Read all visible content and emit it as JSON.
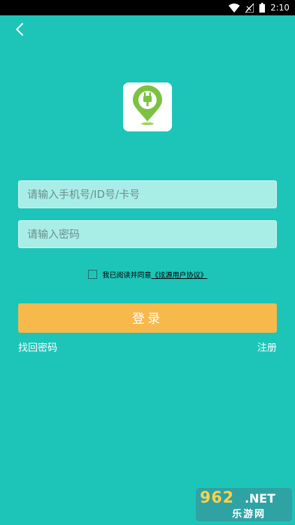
{
  "status_bar": {
    "time": "2:10",
    "icons": [
      "wifi-icon",
      "no-signal-icon",
      "battery-icon"
    ]
  },
  "header": {
    "back_icon": "chevron-left-icon"
  },
  "logo": {
    "icon": "charging-plug-pin-icon",
    "colors": {
      "pin": "#7cc242",
      "plug": "#ffffff"
    }
  },
  "form": {
    "account_placeholder": "请输入手机号/ID号/卡号",
    "account_value": "",
    "password_placeholder": "请输入密码",
    "password_value": "",
    "agreement_text": "我已阅读并同意",
    "agreement_link": "《炫源用户协议》",
    "agreement_checked": false,
    "login_label": "登录",
    "forgot_password_label": "找回密码",
    "register_label": "注册"
  },
  "watermark": {
    "brand": "962",
    "domain": ".NET",
    "name": "乐游网"
  },
  "colors": {
    "background": "#1dc5b9",
    "input_bg": "#a9ede7",
    "login_button": "#f8b94c"
  }
}
